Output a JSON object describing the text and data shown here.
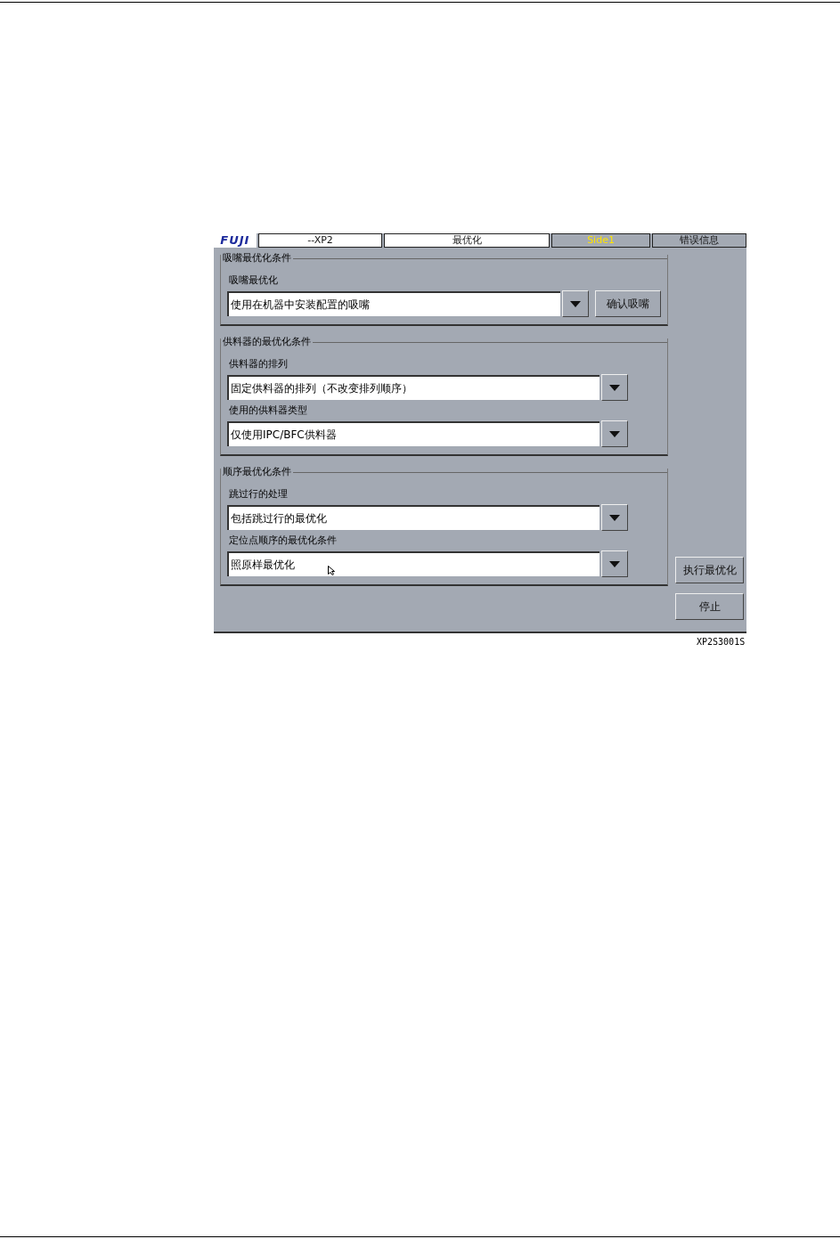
{
  "header": {
    "logo": "FUJI",
    "machine": "--XP2",
    "screen_title": "最优化",
    "side": "Side1",
    "error_button": "错误信息"
  },
  "groups": [
    {
      "title": "吸嘴最优化条件",
      "rows": [
        {
          "label": "吸嘴最优化",
          "value": "使用在机器中安装配置的吸嘴"
        }
      ],
      "button": "确认吸嘴"
    },
    {
      "title": "供料器的最优化条件",
      "rows": [
        {
          "label": "供料器的排列",
          "value": "固定供料器的排列（不改变排列顺序）"
        },
        {
          "label": "使用的供料器类型",
          "value": "仅使用IPC/BFC供料器"
        }
      ]
    },
    {
      "title": "顺序最优化条件",
      "rows": [
        {
          "label": "跳过行的处理",
          "value": "包括跳过行的最优化"
        },
        {
          "label": "定位点顺序的最优化条件",
          "value": "照原样最优化"
        }
      ]
    }
  ],
  "actions": [
    "执行最优化",
    "停止"
  ],
  "caption": "XP2S3001S"
}
